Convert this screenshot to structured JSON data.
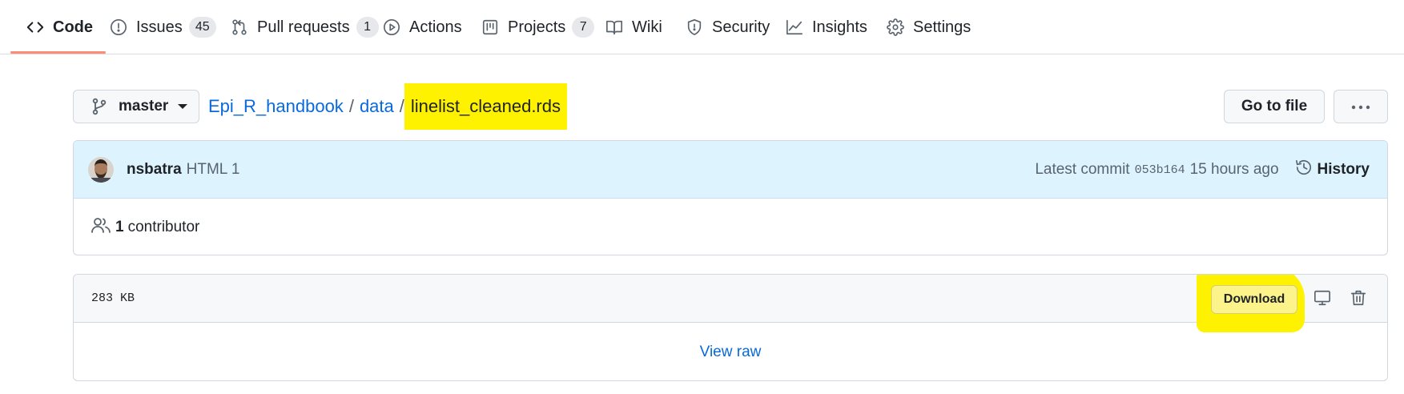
{
  "tabs": [
    {
      "label": "Code",
      "icon": "code-icon",
      "count": null,
      "active": true
    },
    {
      "label": "Issues",
      "icon": "issue-opened-icon",
      "count": "45"
    },
    {
      "label": "Pull requests",
      "icon": "git-pull-request-icon",
      "count": "1"
    },
    {
      "label": "Actions",
      "icon": "play-icon",
      "count": null
    },
    {
      "label": "Projects",
      "icon": "project-icon",
      "count": "7"
    },
    {
      "label": "Wiki",
      "icon": "book-icon",
      "count": null
    },
    {
      "label": "Security",
      "icon": "shield-icon",
      "count": null
    },
    {
      "label": "Insights",
      "icon": "graph-icon",
      "count": null
    },
    {
      "label": "Settings",
      "icon": "gear-icon",
      "count": null
    }
  ],
  "branch": {
    "label": "master"
  },
  "breadcrumb": {
    "repo": "Epi_R_handbook",
    "sep": "/",
    "folder": "data",
    "file": "linelist_cleaned.rds"
  },
  "actions": {
    "goto_file": "Go to file",
    "more": "…"
  },
  "commit": {
    "author": "nsbatra",
    "message": "HTML 1",
    "latest_label": "Latest commit",
    "sha": "053b164",
    "time": "15 hours ago",
    "history": "History"
  },
  "contributors": {
    "count": "1",
    "label": "contributor"
  },
  "file": {
    "size": "283 KB",
    "download": "Download",
    "view_raw": "View raw"
  },
  "colors": {
    "highlight": "#fff200",
    "link": "#0969da",
    "tab_underline": "#fd8c73",
    "commit_bg": "#ddf4ff"
  }
}
